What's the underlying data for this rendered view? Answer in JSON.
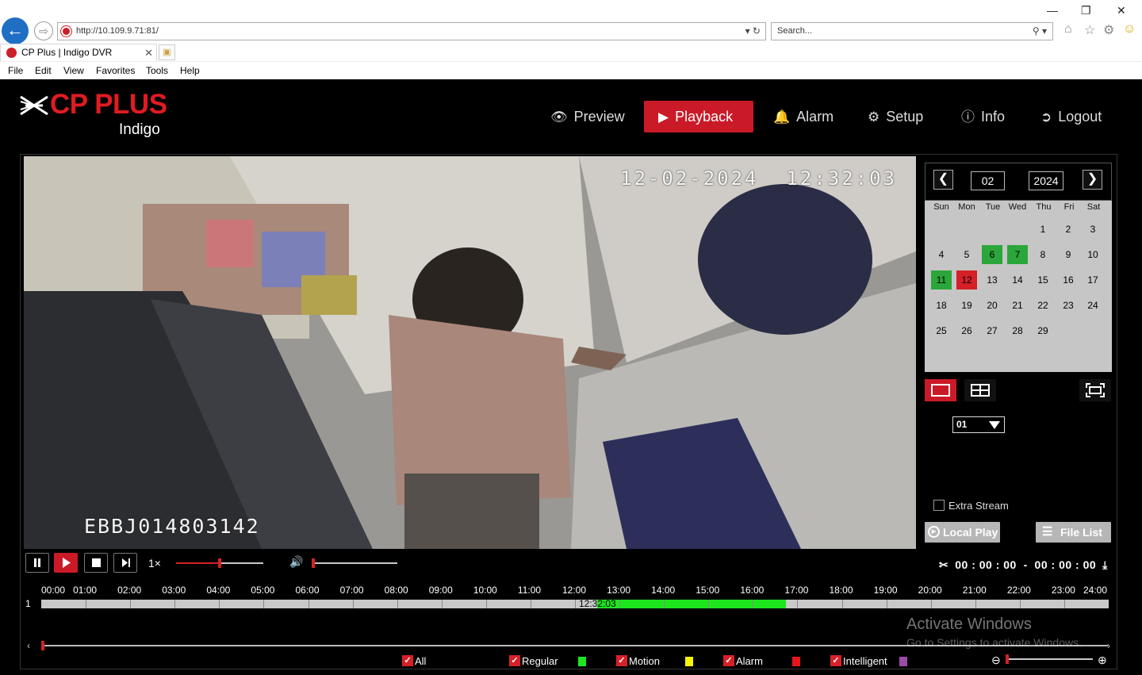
{
  "browser": {
    "url": "http://10.109.9.71:81/",
    "search_placeholder": "Search...",
    "tab_title": "CP Plus | Indigo DVR",
    "menu": [
      "File",
      "Edit",
      "View",
      "Favorites",
      "Tools",
      "Help"
    ]
  },
  "header": {
    "brand": "CP PLUS",
    "sub_brand": "Indigo",
    "nav": [
      {
        "label": "Preview",
        "icon": "eye-icon"
      },
      {
        "label": "Playback",
        "icon": "play-circle-icon",
        "active": true
      },
      {
        "label": "Alarm",
        "icon": "bell-icon"
      },
      {
        "label": "Setup",
        "icon": "gear-icon"
      },
      {
        "label": "Info",
        "icon": "info-icon"
      },
      {
        "label": "Logout",
        "icon": "logout-icon"
      }
    ]
  },
  "video": {
    "osd_timestamp": "12-02-2024  12:32:03",
    "osd_channel_name": "EBBJ014803142"
  },
  "calendar": {
    "month": "02",
    "year": "2024",
    "weekdays": [
      "Sun",
      "Mon",
      "Tue",
      "Wed",
      "Thu",
      "Fri",
      "Sat"
    ],
    "first_weekday_index": 4,
    "days_in_month": 29,
    "record_days": [
      6,
      7,
      11
    ],
    "current_day": 12
  },
  "side": {
    "channel": "01",
    "extra_stream_label": "Extra Stream",
    "extra_stream_checked": false,
    "local_play_label": "Local Play",
    "file_list_label": "File List"
  },
  "controls": {
    "speed": "1×",
    "progress_fraction": 0.5,
    "volume_fraction": 0.0,
    "clip_time": "00 : 00 : 00  -  00 : 00 : 00"
  },
  "timeline": {
    "hour_labels": [
      "00:00",
      "01:00",
      "02:00",
      "03:00",
      "04:00",
      "05:00",
      "06:00",
      "07:00",
      "08:00",
      "09:00",
      "10:00",
      "11:00",
      "12:00",
      "13:00",
      "14:00",
      "15:00",
      "16:00",
      "17:00",
      "18:00",
      "19:00",
      "20:00",
      "21:00",
      "22:00",
      "23:00",
      "24:00"
    ],
    "channel_label": "1",
    "cursor_label": "12:32:03",
    "recordings": [
      {
        "start_hour": 12.5,
        "end_hour": 16.75,
        "type": "regular"
      }
    ]
  },
  "legend": [
    {
      "label": "All",
      "color": ""
    },
    {
      "label": "Regular",
      "color": "#1de61d"
    },
    {
      "label": "Motion",
      "color": "#f5f500"
    },
    {
      "label": "Alarm",
      "color": "#e8141b"
    },
    {
      "label": "Intelligent",
      "color": "#9b4aa8"
    }
  ],
  "zoom_fraction": 0.0,
  "watermark": {
    "line1": "Activate Windows",
    "line2": "Go to Settings to activate Windows."
  },
  "colors": {
    "accent": "#cb1a27",
    "record_green": "#2ba63b"
  }
}
